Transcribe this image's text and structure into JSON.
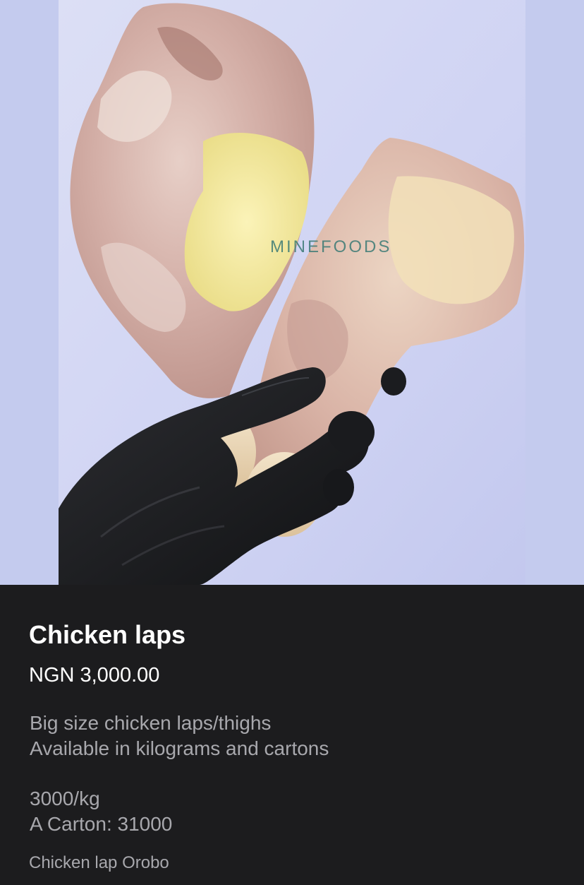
{
  "image": {
    "watermark": "MINEFOODS",
    "alt": "Chicken laps"
  },
  "product": {
    "title": "Chicken laps",
    "price": "NGN 3,000.00",
    "description_lines": [
      "Big size chicken laps/thighs",
      "Available in kilograms and cartons",
      "",
      "3000/kg",
      "A Carton: 31000"
    ],
    "retailer_id": "Chicken lap Orobo"
  },
  "colors": {
    "panel_bg": "#1c1c1e",
    "title_text": "#ffffff",
    "secondary_text": "#a8a8ad",
    "image_backdrop": "#c4cbee"
  }
}
